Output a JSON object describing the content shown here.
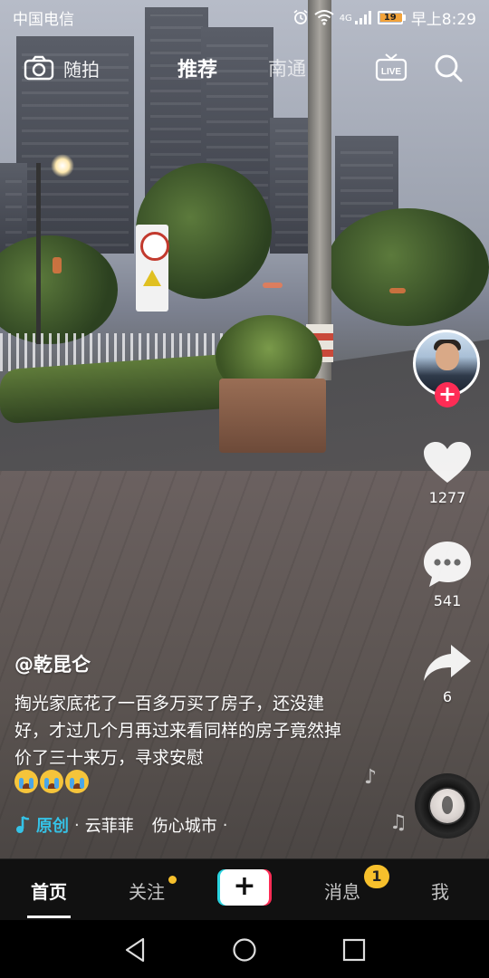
{
  "statusbar": {
    "carrier": "中国电信",
    "network": "4G",
    "battery": "19",
    "time": "早上8:29",
    "battery_color": "#f3a33a"
  },
  "topnav": {
    "camera_label": "随拍",
    "tab_recommend": "推荐",
    "tab_local": "南通",
    "live_label": "LIVE"
  },
  "actions": {
    "like_count": "1277",
    "comment_count": "541",
    "share_count": "6",
    "follow_symbol": "+"
  },
  "post": {
    "author": "@乾昆仑",
    "caption": "掏光家底花了一百多万买了房子，还没建好，才过几个月再过来看同样的房子竟然掉价了三十来万，寻求安慰"
  },
  "music": {
    "original_tag": "原创",
    "sep1": "·",
    "artist": "云菲菲",
    "song": "伤心城市",
    "sep2": "·"
  },
  "tabbar": {
    "home": "首页",
    "follow": "关注",
    "create_symbol": "+",
    "messages": "消息",
    "messages_badge": "1",
    "me": "我",
    "accent_pink": "#fe2c55",
    "accent_cyan": "#2ad3e0",
    "badge_yellow": "#f7c02c"
  }
}
